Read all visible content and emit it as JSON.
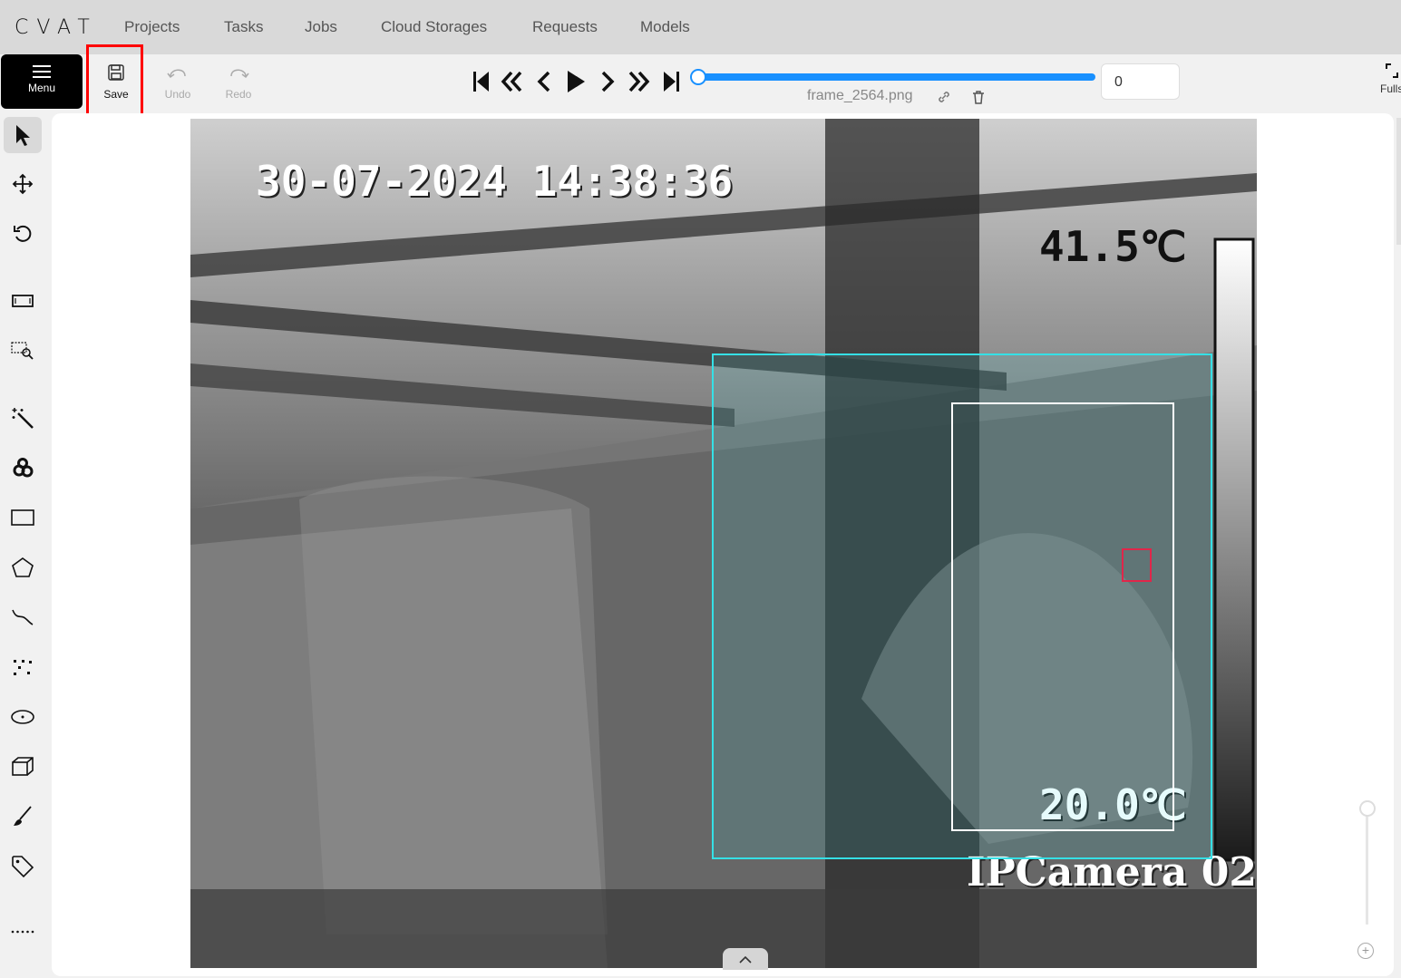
{
  "app": {
    "logo": "CVAT"
  },
  "nav": {
    "items": [
      {
        "label": "Projects"
      },
      {
        "label": "Tasks"
      },
      {
        "label": "Jobs"
      },
      {
        "label": "Cloud Storages"
      },
      {
        "label": "Requests"
      },
      {
        "label": "Models"
      }
    ]
  },
  "toolbar": {
    "menu_label": "Menu",
    "save_label": "Save",
    "undo_label": "Undo",
    "redo_label": "Redo",
    "fullscreen_label": "Fulls"
  },
  "player": {
    "filename": "frame_2564.png",
    "frame_number": "0",
    "progress": 0
  },
  "image": {
    "timestamp": "30-07-2024 14:38:36",
    "temp_max": "41.5℃",
    "temp_min": "20.0℃",
    "camera_label": "IPCamera 02"
  },
  "colors": {
    "accent": "#1890ff",
    "highlight": "#ff0000",
    "box_cyan": "#35e0e6",
    "box_white": "#ffffff",
    "box_red": "#e0264a"
  },
  "sidebar": {
    "tools": [
      "cursor-icon",
      "move-icon",
      "rotate-icon",
      "fit-icon",
      "zoom-region-icon",
      "magic-wand-icon",
      "openvino-icon",
      "rectangle-icon",
      "polygon-icon",
      "polyline-icon",
      "points-icon",
      "ellipse-icon",
      "cuboid-icon",
      "brush-icon",
      "tag-icon",
      "more-icon"
    ]
  }
}
